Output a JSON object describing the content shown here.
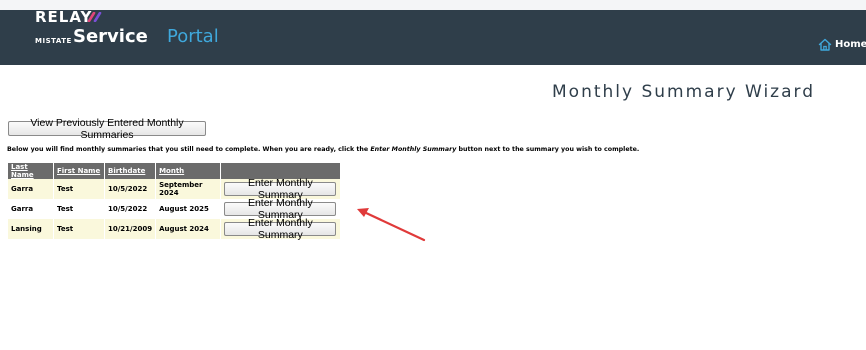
{
  "header": {
    "logo_relay": "RELAY",
    "logo_mistate": "MISTATE",
    "logo_service": "Service",
    "logo_portal": "Portal",
    "home_label": "Home",
    "home_icon": "home-icon"
  },
  "page": {
    "title": "Monthly Summary Wizard",
    "view_previous_button": "View Previously Entered Monthly Summaries",
    "instructions_before": "Below you will find monthly summaries that you still need to complete. When you are ready, click the ",
    "instructions_emph": "Enter Monthly Summary",
    "instructions_after": " button next to the summary you wish to complete."
  },
  "table": {
    "headers": [
      "Last Name",
      "First Name",
      "Birthdate",
      "Month",
      ""
    ],
    "rows": [
      {
        "last": "Garra",
        "first": "Test",
        "birthdate": "10/5/2022",
        "month": "September 2024",
        "action": "Enter Monthly Summary"
      },
      {
        "last": "Garra",
        "first": "Test",
        "birthdate": "10/5/2022",
        "month": "August 2025",
        "action": "Enter Monthly Summary"
      },
      {
        "last": "Lansing",
        "first": "Test",
        "birthdate": "10/21/2009",
        "month": "August 2024",
        "action": "Enter Monthly Summary"
      }
    ]
  },
  "colors": {
    "header_bg": "#2f3e4a",
    "portal_accent": "#3fa8dc",
    "table_header_bg": "#6b6b6b",
    "row_highlight": "#faf8dc",
    "annotation_arrow": "#e03a3a"
  }
}
